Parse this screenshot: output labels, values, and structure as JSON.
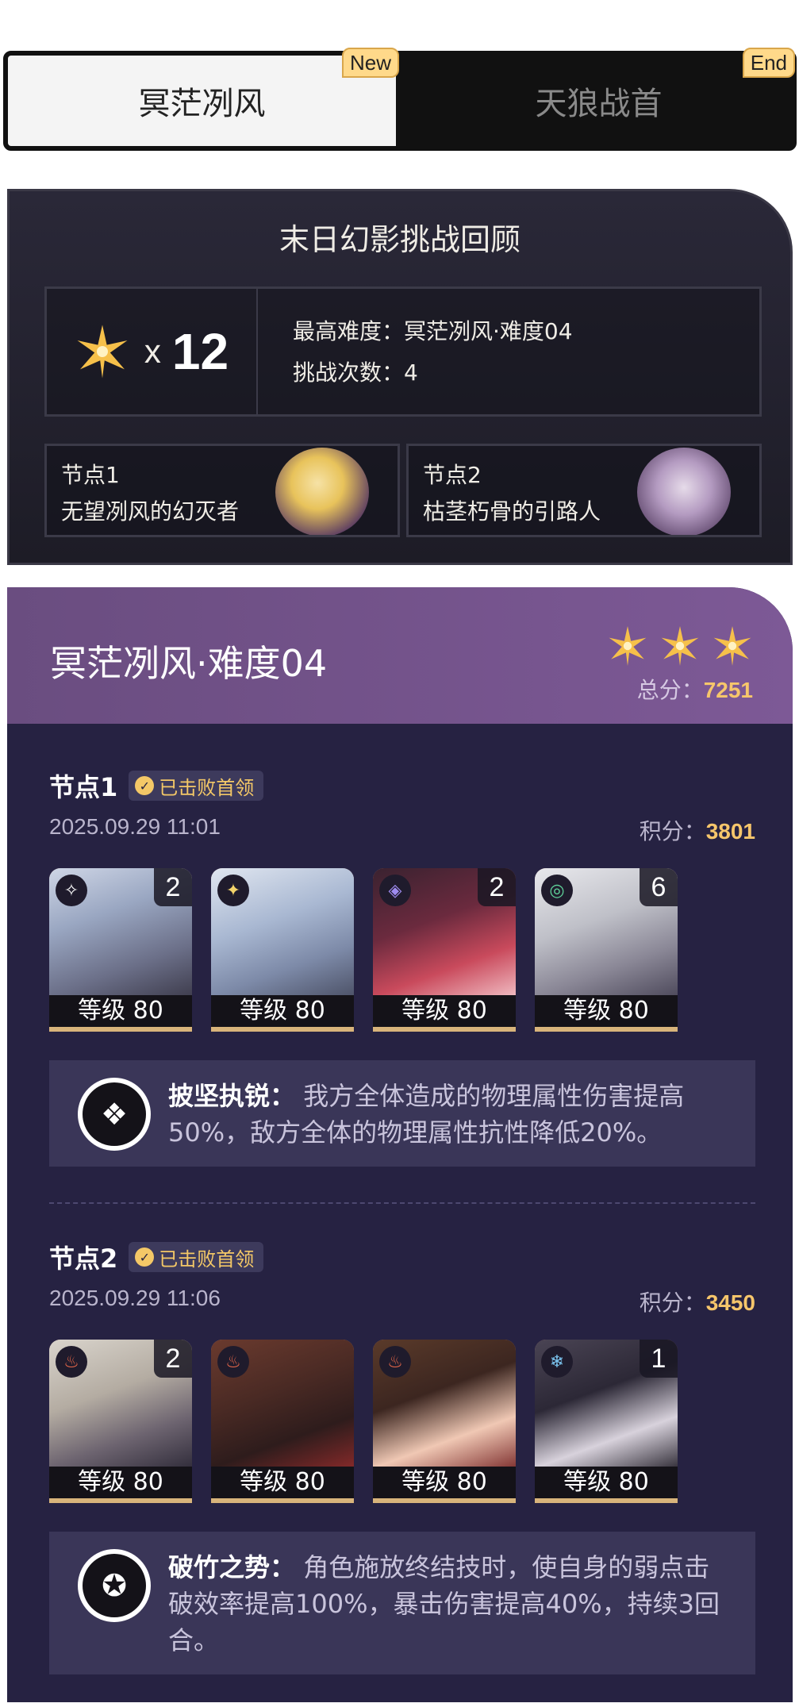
{
  "tabs": [
    {
      "label": "冥茫冽风",
      "badge": "New",
      "active": true
    },
    {
      "label": "天狼战首",
      "badge": "End",
      "active": false
    }
  ],
  "review": {
    "title": "末日幻影挑战回顾",
    "star_x": "x",
    "star_count": "12",
    "max_difficulty": "最高难度：冥茫冽风·难度04",
    "attempts": "挑战次数：4",
    "nodes": [
      {
        "label": "节点1",
        "boss": "无望冽风的幻灭者"
      },
      {
        "label": "节点2",
        "boss": "枯茎朽骨的引路人"
      }
    ]
  },
  "result": {
    "title": "冥茫冽风·难度04",
    "stars": 3,
    "total_label": "总分：",
    "total_value": "7251",
    "nodes": [
      {
        "name": "节点1",
        "badge": "已击败首领",
        "time": "2025.09.29 11:01",
        "score_label": "积分：",
        "score_value": "3801",
        "team": [
          {
            "eidolon": "2",
            "level": "等级 80",
            "element_icon": "physical-icon"
          },
          {
            "eidolon": "",
            "level": "等级 80",
            "element_icon": "imaginary-icon"
          },
          {
            "eidolon": "2",
            "level": "等级 80",
            "element_icon": "quantum-icon"
          },
          {
            "eidolon": "6",
            "level": "等级 80",
            "element_icon": "wind-icon"
          }
        ],
        "buff_name": "披坚执锐：",
        "buff_text": "我方全体造成的物理属性伤害提高50%，敌方全体的物理属性抗性降低20%。"
      },
      {
        "name": "节点2",
        "badge": "已击败首领",
        "time": "2025.09.29 11:06",
        "score_label": "积分：",
        "score_value": "3450",
        "team": [
          {
            "eidolon": "2",
            "level": "等级 80",
            "element_icon": "fire-icon"
          },
          {
            "eidolon": "",
            "level": "等级 80",
            "element_icon": "fire-icon"
          },
          {
            "eidolon": "",
            "level": "等级 80",
            "element_icon": "fire-icon"
          },
          {
            "eidolon": "1",
            "level": "等级 80",
            "element_icon": "ice-icon"
          }
        ],
        "buff_name": "破竹之势：",
        "buff_text": "角色施放终结技时，使自身的弱点击破效率提高100%，暴击伤害提高40%，持续3回合。"
      }
    ]
  },
  "colors": {
    "accent_gold": "#f6c66b",
    "header_purple": "#7d5996",
    "panel_bg": "#262242"
  }
}
